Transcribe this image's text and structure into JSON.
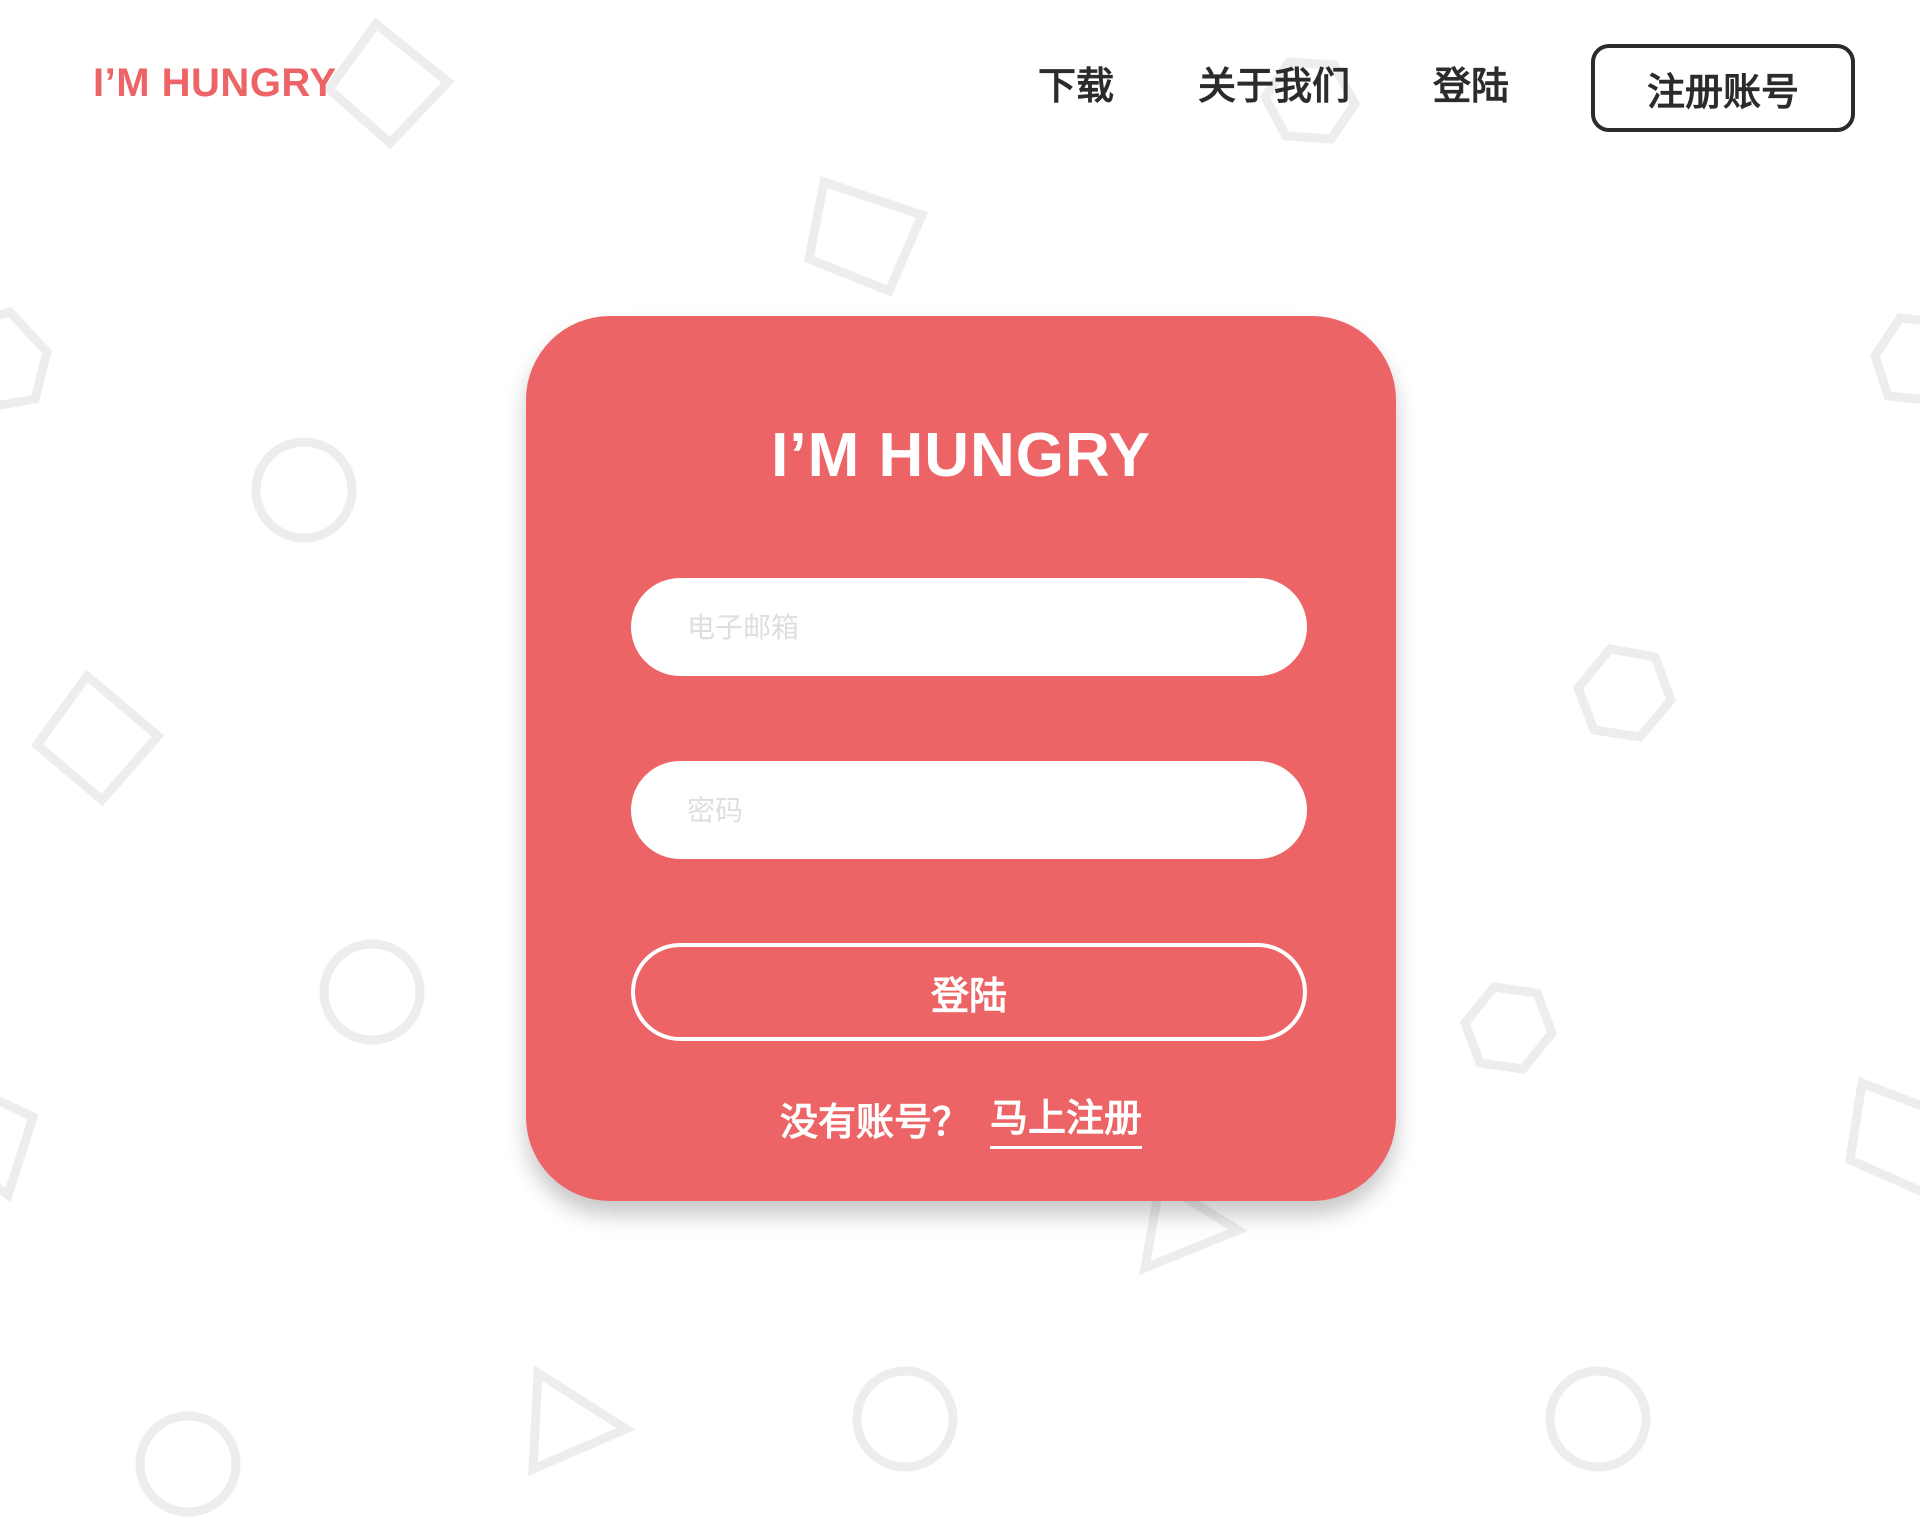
{
  "brand": {
    "logo_text": "I’M HUNGRY",
    "accent_color": "#ec6466",
    "text_color": "#2b2b2b",
    "background_color": "#ffffff",
    "decoration_color": "#ededed"
  },
  "nav": {
    "download": "下载",
    "about": "关于我们",
    "login": "登陆",
    "register": "注册账号"
  },
  "login_card": {
    "title": "I’M HUNGRY",
    "email_placeholder": "电子邮箱",
    "email_value": "",
    "password_placeholder": "密码",
    "password_value": "",
    "submit_label": "登陆",
    "signup_prompt": "没有账号？",
    "signup_link": "马上注册"
  },
  "decorations": [
    {
      "kind": "square",
      "icon": "square-outline-icon"
    },
    {
      "kind": "square",
      "icon": "square-outline-icon"
    },
    {
      "kind": "square",
      "icon": "square-outline-icon"
    },
    {
      "kind": "square",
      "icon": "square-outline-icon"
    },
    {
      "kind": "square",
      "icon": "square-outline-icon"
    },
    {
      "kind": "hexagon",
      "icon": "hexagon-outline-icon"
    },
    {
      "kind": "hexagon",
      "icon": "hexagon-outline-icon"
    },
    {
      "kind": "hexagon",
      "icon": "hexagon-outline-icon"
    },
    {
      "kind": "hexagon",
      "icon": "hexagon-outline-icon"
    },
    {
      "kind": "hexagon",
      "icon": "hexagon-outline-icon"
    },
    {
      "kind": "circle",
      "icon": "circle-outline-icon"
    },
    {
      "kind": "circle",
      "icon": "circle-outline-icon"
    },
    {
      "kind": "circle",
      "icon": "circle-outline-icon"
    },
    {
      "kind": "circle",
      "icon": "circle-outline-icon"
    },
    {
      "kind": "circle",
      "icon": "circle-outline-icon"
    },
    {
      "kind": "triangle",
      "icon": "triangle-outline-icon"
    },
    {
      "kind": "triangle",
      "icon": "triangle-outline-icon"
    }
  ]
}
